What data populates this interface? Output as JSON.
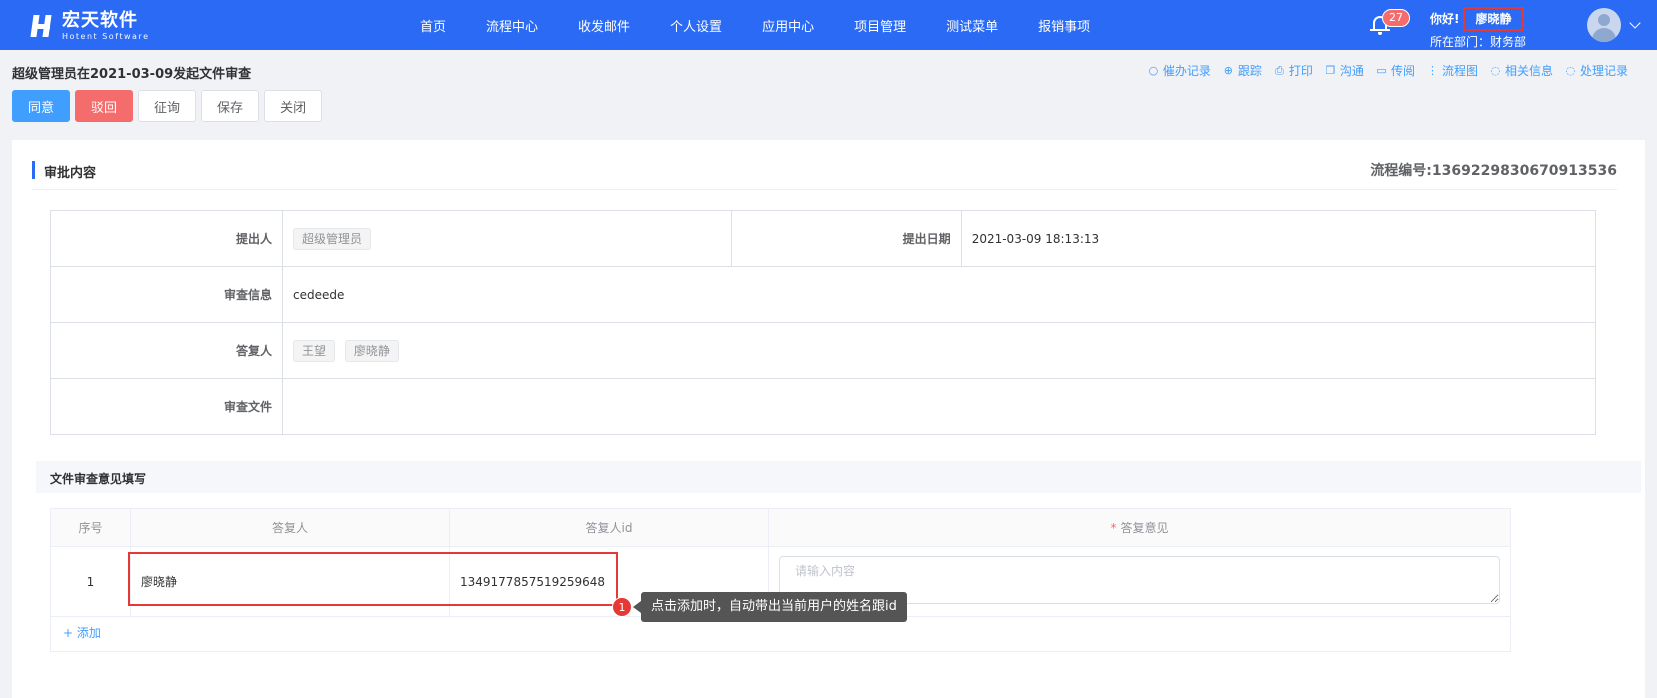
{
  "brand": {
    "name_cn": "宏天软件",
    "name_en": "Hotent Software"
  },
  "nav": {
    "items": [
      "首页",
      "流程中心",
      "收发邮件",
      "个人设置",
      "应用中心",
      "项目管理",
      "测试菜单",
      "报销事项"
    ]
  },
  "header": {
    "notification_count": "27",
    "greeting": "你好!",
    "user_name": "廖晓静",
    "department_label": "所在部门：财务部"
  },
  "page": {
    "title": "超级管理员在2021-03-09发起文件审查"
  },
  "actions": {
    "links": [
      {
        "label": "催办记录",
        "icon": "search-icon"
      },
      {
        "label": "跟踪",
        "icon": "add-circle-icon"
      },
      {
        "label": "打印",
        "icon": "printer-icon"
      },
      {
        "label": "沟通",
        "icon": "copy-icon"
      },
      {
        "label": "传阅",
        "icon": "folder-icon"
      },
      {
        "label": "流程图",
        "icon": "flowchart-icon"
      },
      {
        "label": "相关信息",
        "icon": "chat-icon"
      },
      {
        "label": "处理记录",
        "icon": "chat-icon"
      }
    ]
  },
  "buttons": {
    "agree": "同意",
    "reject": "驳回",
    "consult": "征询",
    "save": "保存",
    "close": "关闭"
  },
  "approval": {
    "section_title": "审批内容",
    "flow_number": "流程编号:1369229830670913536",
    "submitter_label": "提出人",
    "submitter": "超级管理员",
    "date_label": "提出日期",
    "date": "2021-03-09 18:13:13",
    "info_label": "审查信息",
    "info": "cedeede",
    "responders_label": "答复人",
    "responders": [
      "王望",
      "廖晓静"
    ],
    "file_label": "审查文件"
  },
  "opinion": {
    "section_title": "文件审查意见填写",
    "columns": {
      "no": "序号",
      "responder": "答复人",
      "responder_id": "答复人id",
      "opinion": "答复意见"
    },
    "rows": [
      {
        "no": "1",
        "responder": "廖晓静",
        "responder_id": "1349177857519259648",
        "placeholder": "请输入内容"
      }
    ],
    "add_label": "+ 添加"
  },
  "annotation": {
    "number": "1",
    "text": "点击添加时，自动带出当前用户的姓名跟id"
  },
  "colors": {
    "nav_bg": "#2a6af4",
    "primary": "#409eff",
    "danger": "#f56c6c",
    "highlight": "#e53935"
  }
}
